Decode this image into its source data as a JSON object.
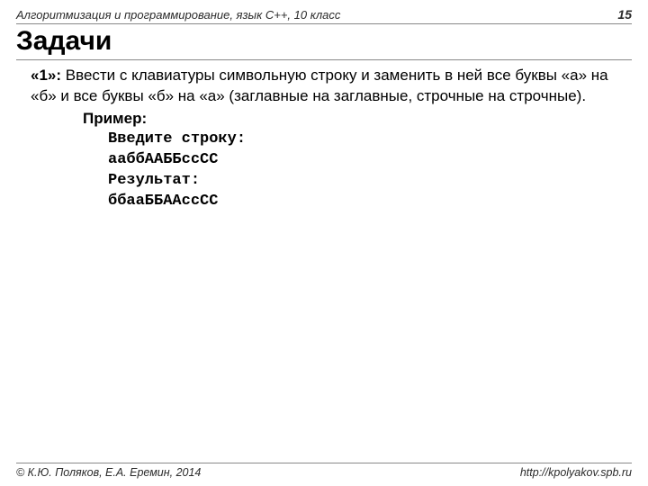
{
  "header": {
    "course": "Алгоритмизация и программирование, язык C++, 10 класс",
    "page_num": "15"
  },
  "title": "Задачи",
  "task": {
    "marker": "«1»:",
    "text": "Ввести с клавиатуры символьную строку и заменить в ней все буквы «а» на «б» и все буквы «б» на «а» (заглавные на заглавные, строчные на строчные).",
    "example_label": "Пример:",
    "lines": {
      "l1": "Введите строку:",
      "l2": "ааббААББссСС",
      "l3": "Результат:",
      "l4": "ббааББААссСС"
    }
  },
  "footer": {
    "copyright": "© К.Ю. Поляков, Е.А. Еремин, 2014",
    "url": "http://kpolyakov.spb.ru"
  }
}
